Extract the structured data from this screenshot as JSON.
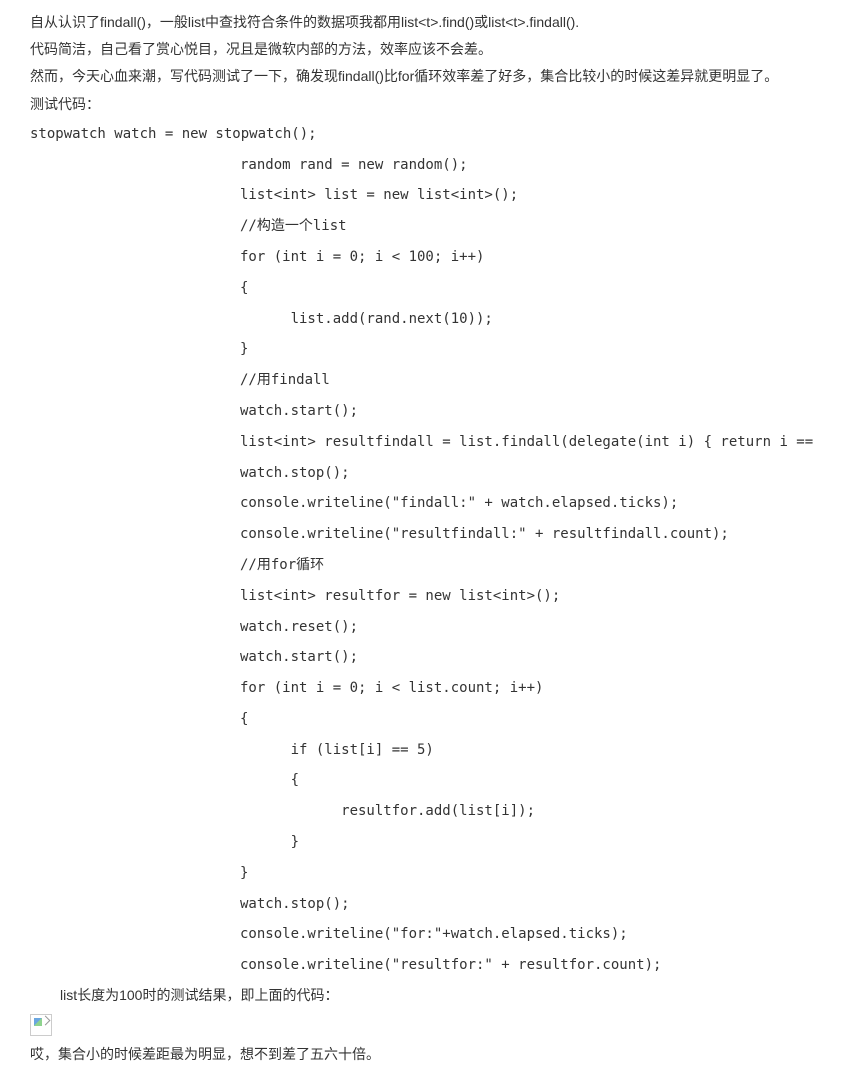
{
  "intro": {
    "p1": "自从认识了findall()，一般list中查找符合条件的数据项我都用list<t>.find()或list<t>.findall().",
    "p2": "代码简洁，自己看了赏心悦目，况且是微软内部的方法，效率应该不会差。",
    "p3": "然而，今天心血来潮，写代码测试了一下，确发现findall()比for循环效率差了好多，集合比较小的时候这差异就更明显了。",
    "p4": "测试代码："
  },
  "code": {
    "l01": "stopwatch watch = new stopwatch();",
    "l02": "random rand = new random();",
    "l03": "list<int> list = new list<int>();",
    "l04": "//构造一个list",
    "l05": "for (int i = 0; i < 100; i++)",
    "l06": "{",
    "l07": "      list.add(rand.next(10));",
    "l08": "}",
    "l09": "//用findall",
    "l10": "watch.start();",
    "l11": "list<int> resultfindall = list.findall(delegate(int i) { return i ==",
    "l12": "watch.stop();",
    "l13": "console.writeline(\"findall:\" + watch.elapsed.ticks);",
    "l14": "console.writeline(\"resultfindall:\" + resultfindall.count);",
    "l15": "//用for循环",
    "l16": "list<int> resultfor = new list<int>();",
    "l17": "watch.reset();",
    "l18": "watch.start();",
    "l19": "for (int i = 0; i < list.count; i++)",
    "l20": "{",
    "l21": "      if (list[i] == 5)",
    "l22": "      {",
    "l23": "            resultfor.add(list[i]);",
    "l24": "      }",
    "l25": "}",
    "l26": "watch.stop();",
    "l27": "console.writeline(\"for:\"+watch.elapsed.ticks);",
    "l28": "console.writeline(\"resultfor:\" + resultfor.count);"
  },
  "outro": {
    "p1": "list长度为100时的测试结果，即上面的代码：",
    "p2": "哎，集合小的时候差距最为明显，想不到差了五六十倍。"
  }
}
